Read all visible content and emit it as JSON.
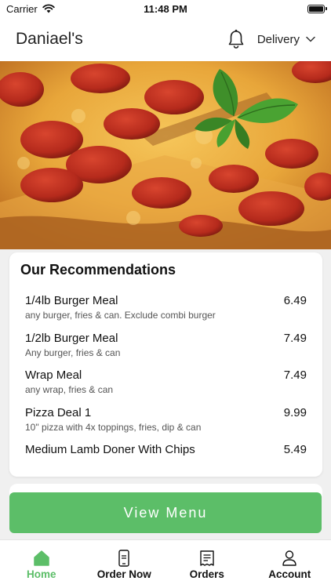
{
  "status_bar": {
    "carrier": "Carrier",
    "time": "11:48 PM"
  },
  "header": {
    "title": "Daniael's",
    "delivery_label": "Delivery"
  },
  "recommendations": {
    "title": "Our Recommendations",
    "items": [
      {
        "name": "1/4lb Burger Meal",
        "description": "any burger, fries & can. Exclude combi burger",
        "price": "6.49"
      },
      {
        "name": "1/2lb Burger Meal",
        "description": "Any burger, fries & can",
        "price": "7.49"
      },
      {
        "name": "Wrap Meal",
        "description": "any wrap, fries & can",
        "price": "7.49"
      },
      {
        "name": "Pizza Deal 1",
        "description": "10\" pizza with 4x toppings, fries, dip & can",
        "price": "9.99"
      },
      {
        "name": "Medium Lamb Doner With Chips",
        "description": "",
        "price": "5.49"
      }
    ]
  },
  "view_menu_label": "View Menu",
  "tabs": [
    {
      "label": "Home",
      "icon": "home-icon",
      "active": true
    },
    {
      "label": "Order Now",
      "icon": "phone-order-icon",
      "active": false
    },
    {
      "label": "Orders",
      "icon": "receipt-icon",
      "active": false
    },
    {
      "label": "Account",
      "icon": "user-icon",
      "active": false
    }
  ],
  "colors": {
    "accent": "#5cbe68",
    "text": "#111111",
    "muted": "#555555",
    "background": "#f0f0f0"
  }
}
